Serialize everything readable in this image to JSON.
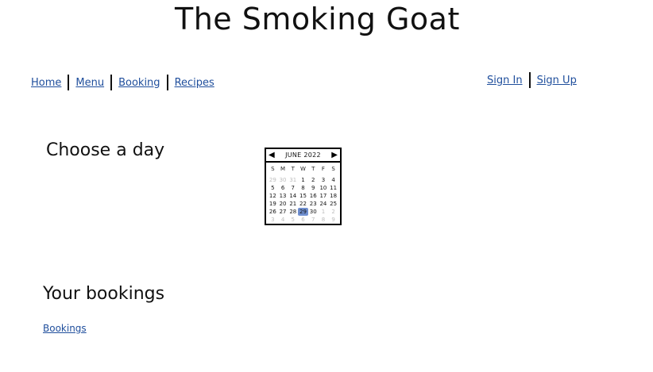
{
  "site": {
    "title": "The Smoking Goat"
  },
  "nav": {
    "main": [
      "Home",
      "Menu",
      "Booking",
      "Recipes"
    ],
    "auth": [
      "Sign In",
      "Sign Up"
    ]
  },
  "choose": {
    "title": "Choose a day"
  },
  "calendar": {
    "month_label": "JUNE 2022",
    "weekdays": [
      "S",
      "M",
      "T",
      "W",
      "T",
      "F",
      "S"
    ],
    "weeks": [
      [
        {
          "d": "29",
          "m": true
        },
        {
          "d": "30",
          "m": true
        },
        {
          "d": "31",
          "m": true
        },
        {
          "d": "1"
        },
        {
          "d": "2"
        },
        {
          "d": "3"
        },
        {
          "d": "4"
        }
      ],
      [
        {
          "d": "5"
        },
        {
          "d": "6"
        },
        {
          "d": "7"
        },
        {
          "d": "8"
        },
        {
          "d": "9"
        },
        {
          "d": "10"
        },
        {
          "d": "11"
        }
      ],
      [
        {
          "d": "12"
        },
        {
          "d": "13"
        },
        {
          "d": "14"
        },
        {
          "d": "15"
        },
        {
          "d": "16"
        },
        {
          "d": "17"
        },
        {
          "d": "18"
        }
      ],
      [
        {
          "d": "19"
        },
        {
          "d": "20"
        },
        {
          "d": "21"
        },
        {
          "d": "22"
        },
        {
          "d": "23"
        },
        {
          "d": "24"
        },
        {
          "d": "25"
        }
      ],
      [
        {
          "d": "26"
        },
        {
          "d": "27"
        },
        {
          "d": "28"
        },
        {
          "d": "29",
          "sel": true
        },
        {
          "d": "30"
        },
        {
          "d": "1",
          "m": true
        },
        {
          "d": "2",
          "m": true
        }
      ],
      [
        {
          "d": "3",
          "m": true
        },
        {
          "d": "4",
          "m": true
        },
        {
          "d": "5",
          "m": true
        },
        {
          "d": "6",
          "m": true
        },
        {
          "d": "7",
          "m": true
        },
        {
          "d": "8",
          "m": true
        },
        {
          "d": "9",
          "m": true
        }
      ]
    ],
    "selected_color": "#6f8fd0"
  },
  "bookings": {
    "title": "Your bookings",
    "link": "Bookings"
  },
  "colors": {
    "link": "#1f4e9c",
    "text": "#111111"
  }
}
